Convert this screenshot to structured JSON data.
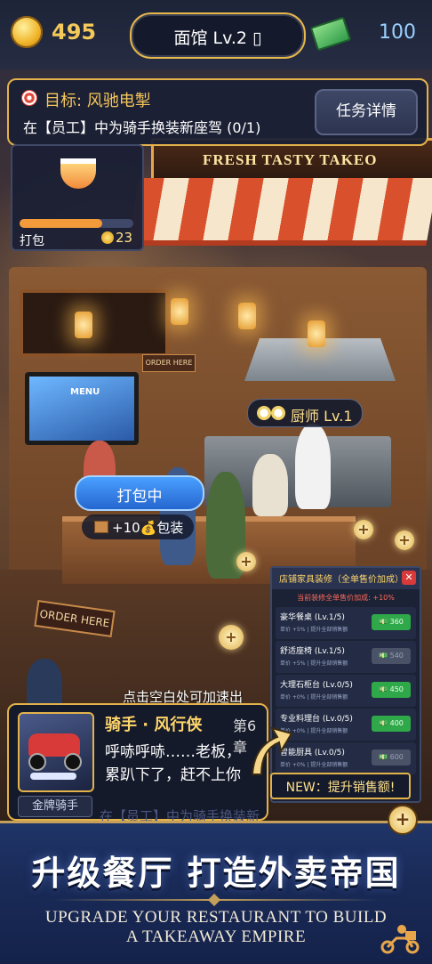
{
  "topbar": {
    "coins": "495",
    "restaurant_level": "面馆 Lv.2 ▯",
    "cash": "100"
  },
  "goal": {
    "title": "目标: 风驰电掣",
    "description": "在【员工】中为骑手换装新座驾 (0/1)",
    "details_button": "任务详情"
  },
  "pack_card": {
    "label": "打包",
    "reward": "23",
    "progress": 0.73
  },
  "scene": {
    "shop_sign": "FRESH TASTY TAKEO",
    "tv_menu_title": "MENU",
    "order_sign": "ORDER HERE",
    "chef_label": "厨师 Lv.1",
    "packing_status": "打包中",
    "packing_bonus": "+10💰包装",
    "tap_hint": "点击空白处可加速出"
  },
  "decoration_panel": {
    "title": "店铺家具装修（全单售价加成）",
    "subtitle": "当前装修全单售价加成: +10%",
    "items": [
      {
        "name": "豪华餐桌 (Lv.1/5)",
        "desc": "单价 +5% | 提升全部销售额",
        "price": "💵 360",
        "available": true
      },
      {
        "name": "舒适座椅 (Lv.1/5)",
        "desc": "单价 +5% | 提升全部销售额",
        "price": "💵 540",
        "available": false
      },
      {
        "name": "大理石柜台 (Lv.0/5)",
        "desc": "单价 +0% | 提升全部销售额",
        "price": "💵 450",
        "available": true
      },
      {
        "name": "专业料理台 (Lv.0/5)",
        "desc": "单价 +0% | 提升全部销售额",
        "price": "💵 400",
        "available": true
      },
      {
        "name": "智能厨具 (Lv.0/5)",
        "desc": "单价 +0% | 提升全部销售额",
        "price": "💵 600",
        "available": false
      }
    ],
    "new_callout": "NEW：提升销售额!"
  },
  "dialog": {
    "speaker": "骑手 · 风行侠",
    "chapter": "第6章",
    "line1": "呼哧呼哧……老板，",
    "line2": "累趴下了，赶不上你",
    "badge": "金牌骑手",
    "ticker": "在【员工】中为骑手换装新"
  },
  "promo": {
    "headline_cn": "升级餐厅 打造外卖帝国",
    "headline_en_line1": "UPGRADE YOUR RESTAURANT TO BUILD",
    "headline_en_line2": "A TAKEAWAY EMPIRE"
  },
  "colors": {
    "accent_gold": "#e3b24a",
    "panel_navy": "#1b2034",
    "buy_green": "#2fa84a",
    "close_red": "#d83a3a"
  },
  "icons": [
    "coin-icon",
    "cash-icon",
    "target-icon",
    "bowl-icon",
    "chef-icon",
    "package-icon",
    "close-icon",
    "plus-icon",
    "arrow-icon",
    "rider-icon"
  ]
}
